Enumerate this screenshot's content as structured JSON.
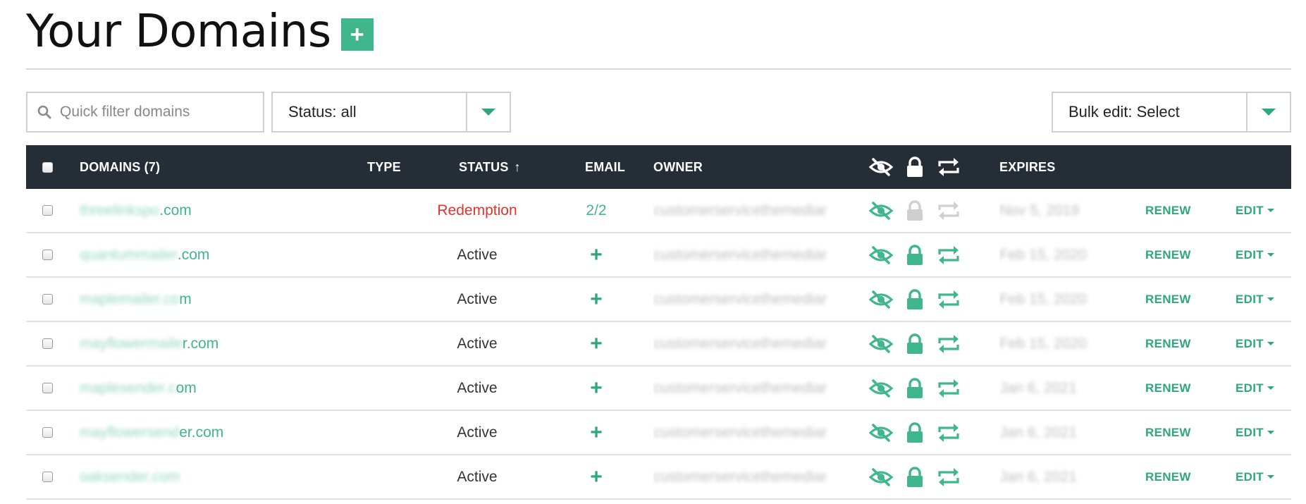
{
  "header": {
    "title": "Your Domains",
    "add_label": "+"
  },
  "filters": {
    "search_placeholder": "Quick filter domains",
    "status_select": "Status: all",
    "bulk_edit_select": "Bulk edit: Select"
  },
  "table": {
    "columns": {
      "domains": "DOMAINS (7)",
      "type": "TYPE",
      "status": "STATUS",
      "status_sort_arrow": "↑",
      "email": "EMAIL",
      "owner": "OWNER",
      "expires": "EXPIRES"
    },
    "rows": [
      {
        "domain_blur": "threelinkspo",
        "domain_visible": ".com",
        "status": "Redemption",
        "email": "2/2",
        "owner": "customerservicethemediar",
        "expires": "Nov 5, 2019",
        "renew": "RENEW",
        "edit": "EDIT"
      },
      {
        "domain_blur": "quantummailer",
        "domain_visible": ".com",
        "status": "Active",
        "email": "+",
        "owner": "customerservicethemediar",
        "expires": "Feb 15, 2020",
        "renew": "RENEW",
        "edit": "EDIT"
      },
      {
        "domain_blur": "maplemailer.co",
        "domain_visible": "m",
        "status": "Active",
        "email": "+",
        "owner": "customerservicethemediar",
        "expires": "Feb 15, 2020",
        "renew": "RENEW",
        "edit": "EDIT"
      },
      {
        "domain_blur": "mayflowermaile",
        "domain_visible": "r.com",
        "status": "Active",
        "email": "+",
        "owner": "customerservicethemediar",
        "expires": "Feb 15, 2020",
        "renew": "RENEW",
        "edit": "EDIT"
      },
      {
        "domain_blur": "maplesender.c",
        "domain_visible": "om",
        "status": "Active",
        "email": "+",
        "owner": "customerservicethemediar",
        "expires": "Jan 6, 2021",
        "renew": "RENEW",
        "edit": "EDIT"
      },
      {
        "domain_blur": "mayflowersend",
        "domain_visible": "er.com",
        "status": "Active",
        "email": "+",
        "owner": "customerservicethemediar",
        "expires": "Jan 6, 2021",
        "renew": "RENEW",
        "edit": "EDIT"
      },
      {
        "domain_blur": "oaksender.com",
        "domain_visible": "",
        "status": "Active",
        "email": "+",
        "owner": "customerservicethemediar",
        "expires": "Jan 6, 2021",
        "renew": "RENEW",
        "edit": "EDIT"
      }
    ]
  },
  "colors": {
    "accent": "#3fb68b",
    "header_bg": "#252d36",
    "redemption": "#e5322d",
    "disabled_icon": "#cfcfcf"
  },
  "icons": [
    "search-icon",
    "chevron-down-icon",
    "privacy-eye-slash-icon",
    "lock-icon",
    "auto-renew-icon"
  ]
}
